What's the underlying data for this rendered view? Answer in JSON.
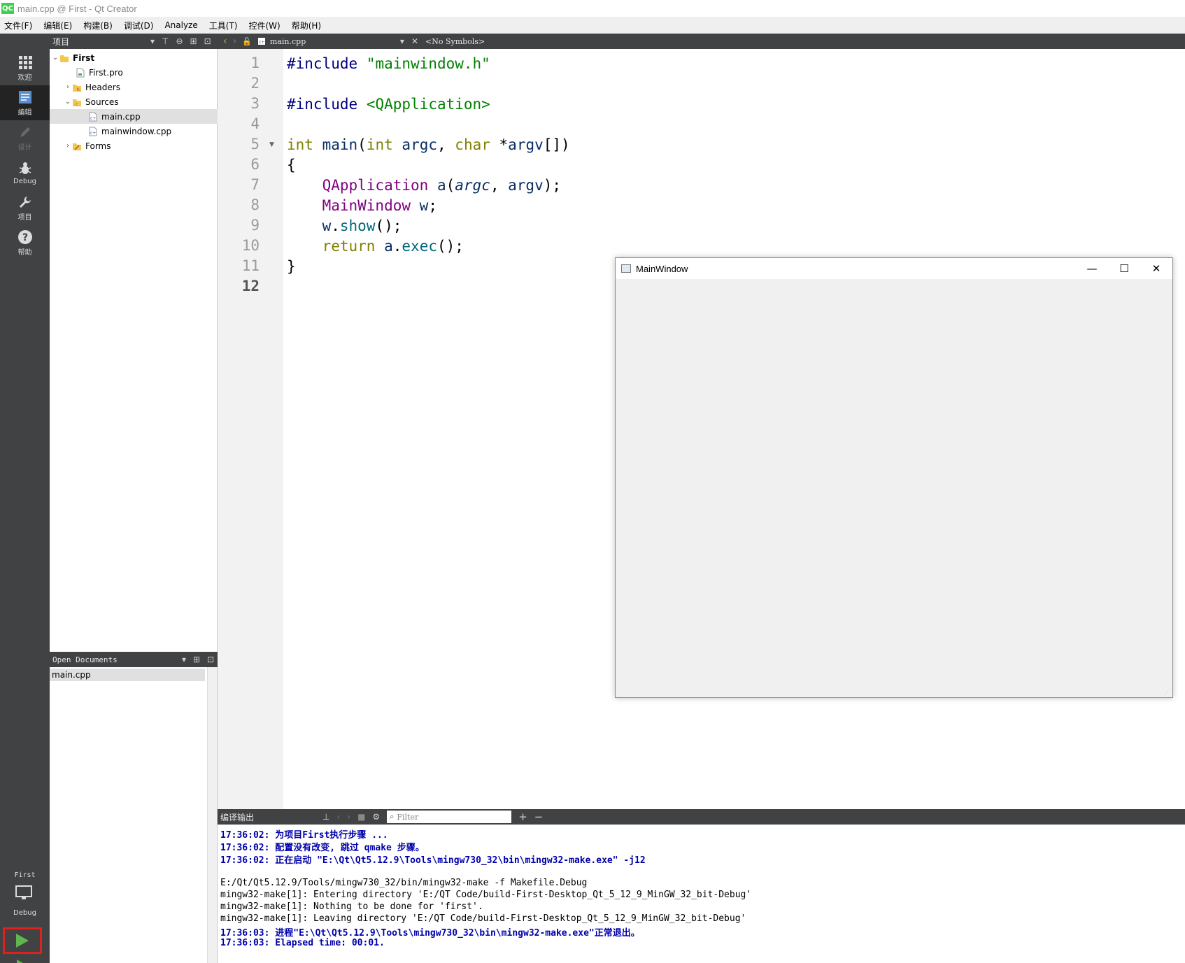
{
  "window": {
    "title": "main.cpp @ First - Qt Creator",
    "logo": "QC"
  },
  "menu": [
    "文件(F)",
    "编辑(E)",
    "构建(B)",
    "调试(D)",
    "Analyze",
    "工具(T)",
    "控件(W)",
    "帮助(H)"
  ],
  "modes": [
    {
      "label": "欢迎",
      "icon": "grid-icon"
    },
    {
      "label": "编辑",
      "icon": "edit-document-icon",
      "active": true
    },
    {
      "label": "设计",
      "icon": "pencil-icon",
      "disabled": true
    },
    {
      "label": "Debug",
      "icon": "bug-icon"
    },
    {
      "label": "项目",
      "icon": "wrench-icon"
    },
    {
      "label": "帮助",
      "icon": "help-icon"
    }
  ],
  "kit": {
    "project": "First",
    "build": "Debug"
  },
  "projects": {
    "title": "项目",
    "tree": [
      {
        "label": "First",
        "level": 0,
        "expanded": true,
        "bold": true
      },
      {
        "label": "First.pro",
        "level": 1
      },
      {
        "label": "Headers",
        "level": 1,
        "collapsed": true
      },
      {
        "label": "Sources",
        "level": 1,
        "expanded": true
      },
      {
        "label": "main.cpp",
        "level": 2,
        "selected": true
      },
      {
        "label": "mainwindow.cpp",
        "level": 2
      },
      {
        "label": "Forms",
        "level": 1,
        "collapsed": true
      }
    ]
  },
  "open_documents": {
    "title": "Open Documents",
    "items": [
      "main.cpp"
    ]
  },
  "editor": {
    "file": "main.cpp",
    "symbols": "<No Symbols>",
    "line_numbers": [
      "1",
      "2",
      "3",
      "4",
      "5",
      "6",
      "7",
      "8",
      "9",
      "10",
      "11",
      "12"
    ],
    "current_line": "12"
  },
  "main_window": {
    "title": "MainWindow",
    "minimize": "—",
    "maximize": "☐",
    "close": "✕"
  },
  "output": {
    "title": "编译输出",
    "filter_placeholder": "Filter",
    "lines": [
      {
        "text": "17:36:02: 为项目First执行步骤 ...",
        "blue": true
      },
      {
        "text": "17:36:02: 配置没有改变, 跳过 qmake 步骤。",
        "blue": true
      },
      {
        "text": "17:36:02: 正在启动 \"E:\\Qt\\Qt5.12.9\\Tools\\mingw730_32\\bin\\mingw32-make.exe\" -j12",
        "blue": true
      },
      {
        "text": ""
      },
      {
        "text": "E:/Qt/Qt5.12.9/Tools/mingw730_32/bin/mingw32-make -f Makefile.Debug"
      },
      {
        "text": "mingw32-make[1]: Entering directory 'E:/QT Code/build-First-Desktop_Qt_5_12_9_MinGW_32_bit-Debug'"
      },
      {
        "text": "mingw32-make[1]: Nothing to be done for 'first'."
      },
      {
        "text": "mingw32-make[1]: Leaving directory 'E:/QT Code/build-First-Desktop_Qt_5_12_9_MinGW_32_bit-Debug'"
      },
      {
        "text": "17:36:03: 进程\"E:\\Qt\\Qt5.12.9\\Tools\\mingw730_32\\bin\\mingw32-make.exe\"正常退出。",
        "blue": true
      },
      {
        "text": "17:36:03: Elapsed time: 00:01.",
        "blue": true
      }
    ]
  },
  "code": {
    "l1_pp": "#include",
    "l1_str": "\"mainwindow.h\"",
    "l3_pp": "#include",
    "l3_str": "<QApplication>",
    "l5_int": "int",
    "l5_main": "main",
    "l5_int2": "int",
    "l5_argc": "argc",
    "l5_char": "char",
    "l5_argv": "argv",
    "l6_brace": "{",
    "l7_type": "QApplication",
    "l7_var": "a",
    "l7_argc": "argc",
    "l7_argv": "argv",
    "l8_type": "MainWindow",
    "l8_var": "w",
    "l9_var": "w",
    "l9_fn": "show",
    "l10_ret": "return",
    "l10_var": "a",
    "l10_fn": "exec",
    "l11_brace": "}"
  }
}
